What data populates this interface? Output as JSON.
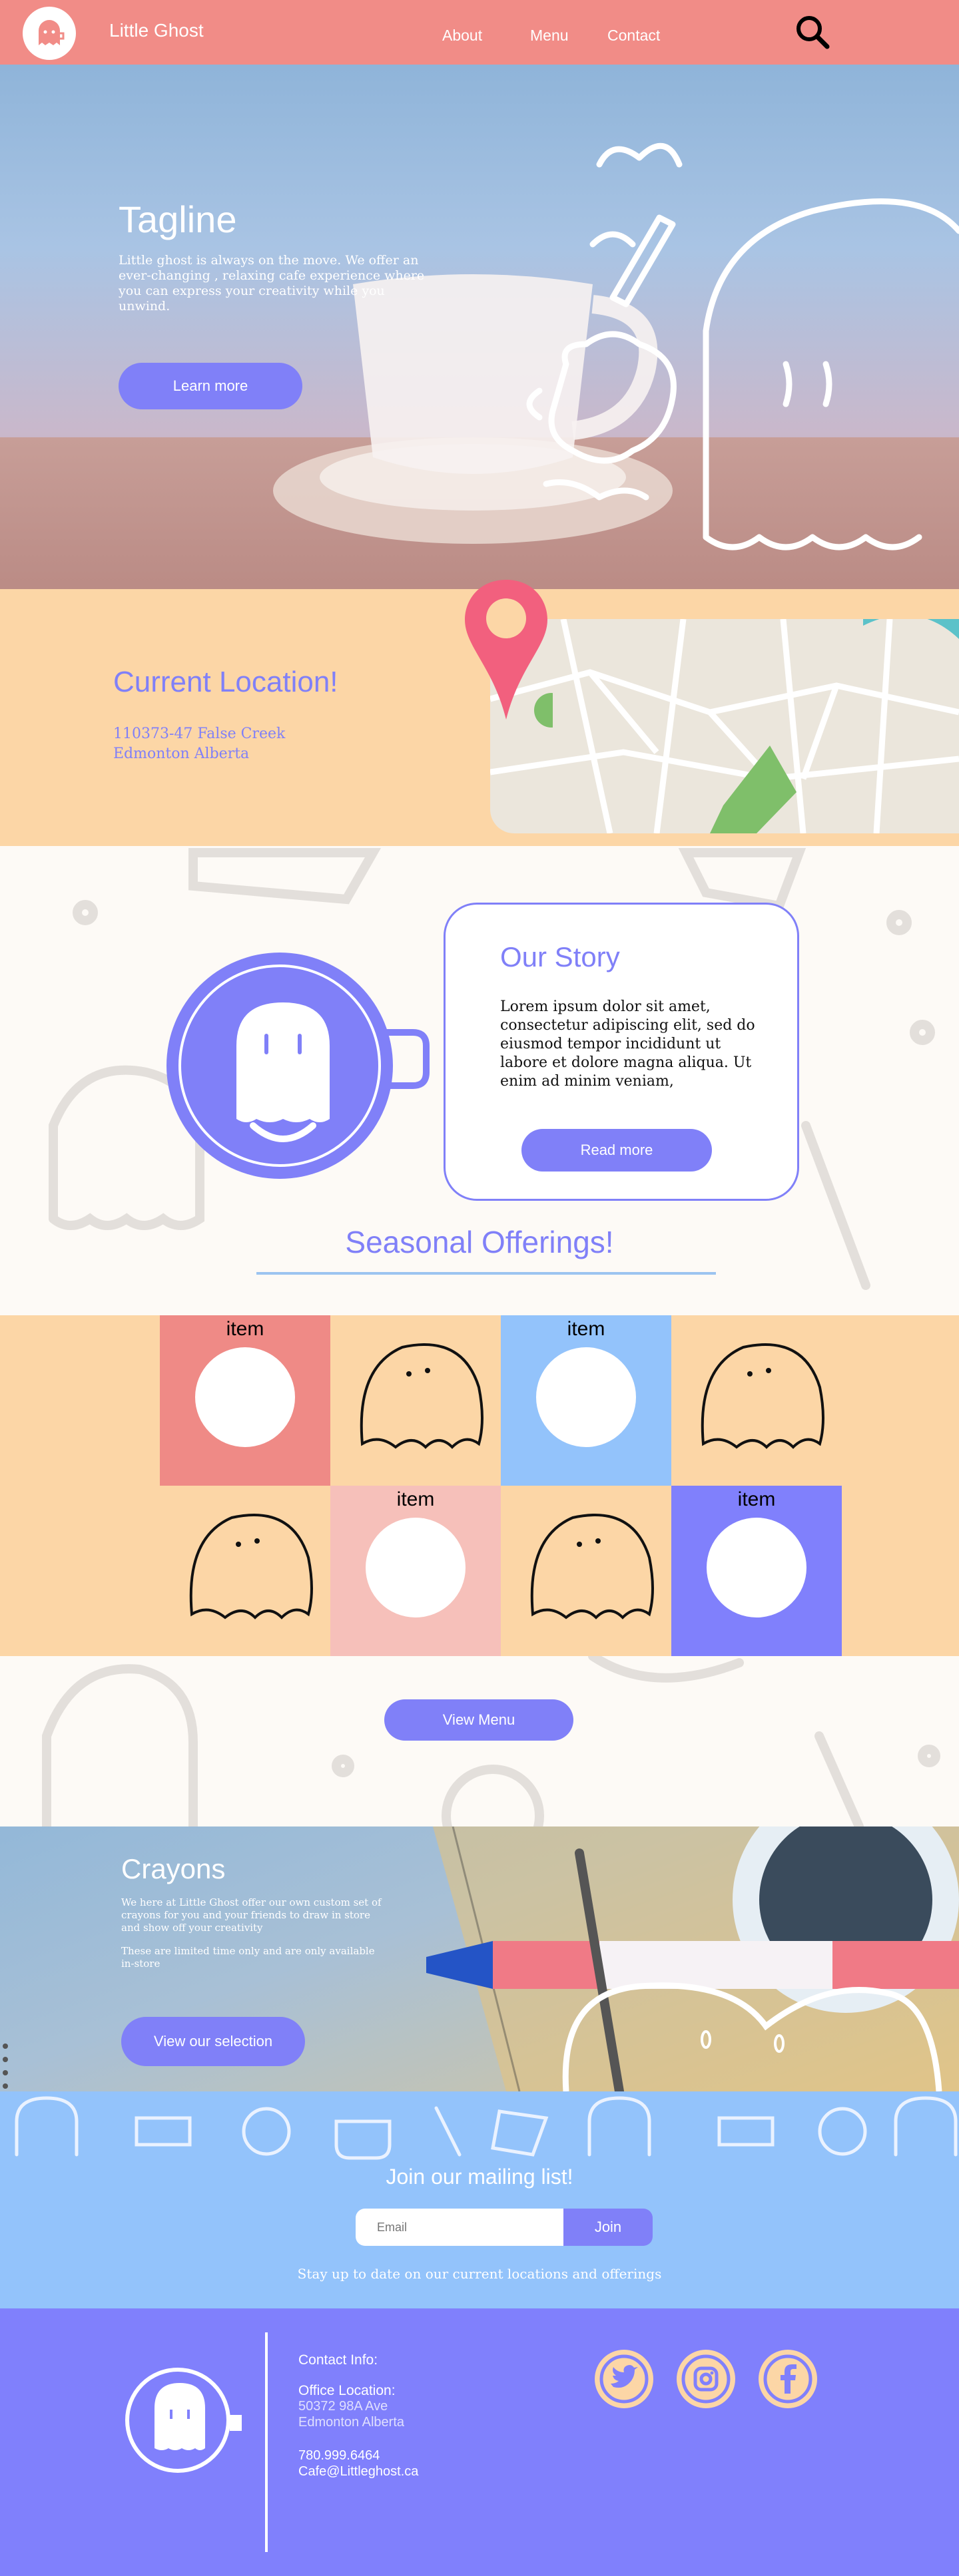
{
  "nav": {
    "brand": "Little Ghost",
    "links": [
      "About",
      "Menu",
      "Contact"
    ]
  },
  "hero": {
    "title": "Tagline",
    "text": "Little ghost is always on the move. We offer an ever-changing , relaxing cafe experience where you can express your creativity while you unwind.",
    "button": "Learn more"
  },
  "location": {
    "title": "Current Location!",
    "line1": "110373-47 False Creek",
    "line2": "Edmonton Alberta"
  },
  "story": {
    "title": "Our Story",
    "text": "Lorem ipsum dolor sit amet, consectetur adipiscing elit, sed do eiusmod tempor incididunt ut labore et dolore magna aliqua. Ut enim ad minim veniam,",
    "button": "Read more"
  },
  "seasonal": {
    "title": "Seasonal Offerings!",
    "item_label": "item"
  },
  "viewmenu": {
    "button": "View Menu"
  },
  "crayons": {
    "title": "Crayons",
    "text1": "We here at Little Ghost offer our own custom set of crayons for you and your friends to draw in store and show off your creativity",
    "text2": "These are limited time only and are only available in-store",
    "button": "View our selection"
  },
  "mailing": {
    "title": "Join our mailing list!",
    "placeholder": "Email",
    "button": "Join",
    "subtext": "Stay up to date on our current locations and offerings"
  },
  "footer": {
    "contact_heading": "Contact Info:",
    "office_heading": "Office Location:",
    "office_line1": "50372 98A Ave",
    "office_line2": "Edmonton Alberta",
    "phone": "780.999.6464",
    "email": "Cafe@Littleghost.ca"
  },
  "colors": {
    "nav": "#f18c87",
    "accent": "#8080f8",
    "peach": "#fcd6a6",
    "sky": "#93c3fb"
  },
  "icons": [
    "ghost-logo-icon",
    "search-icon",
    "map-pin-icon",
    "twitter-icon",
    "instagram-icon",
    "facebook-icon"
  ]
}
